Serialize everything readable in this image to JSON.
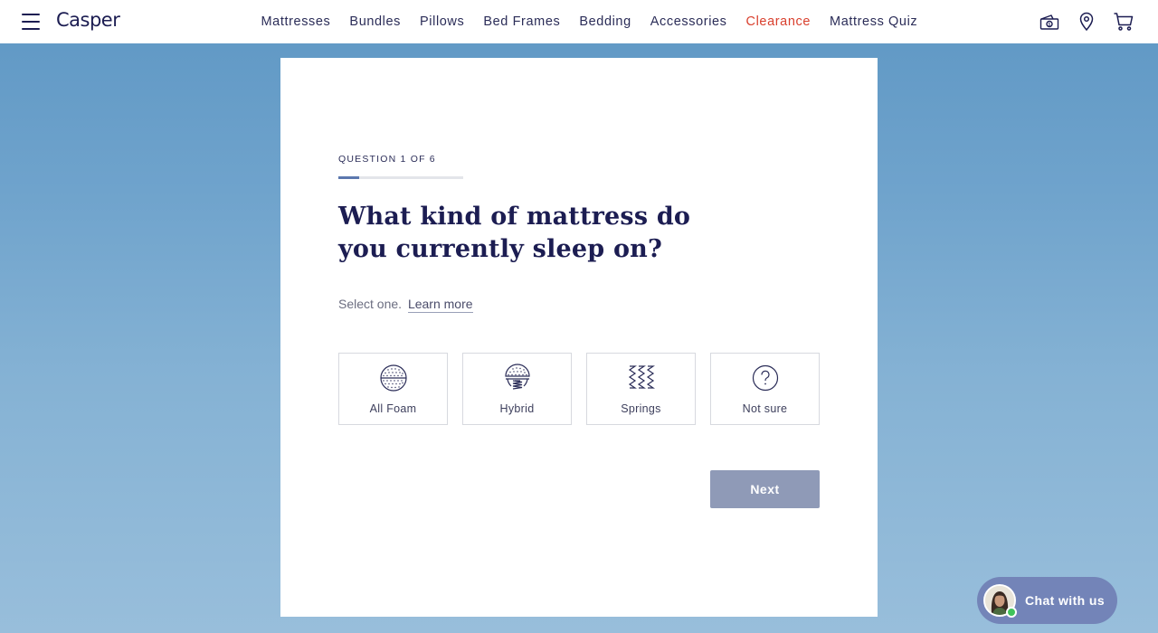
{
  "header": {
    "logo": "Casper",
    "nav": [
      "Mattresses",
      "Bundles",
      "Pillows",
      "Bed Frames",
      "Bedding",
      "Accessories",
      "Clearance",
      "Mattress Quiz"
    ],
    "icons": [
      "financing-icon",
      "location-pin-icon",
      "cart-icon"
    ]
  },
  "quiz": {
    "question_count": "QUESTION 1 OF 6",
    "progress": 0.1667,
    "title": "What kind of mattress do you currently sleep on?",
    "help_text": "Select one.",
    "learn_more": "Learn more",
    "options": [
      {
        "label": "All Foam",
        "icon": "foam-icon"
      },
      {
        "label": "Hybrid",
        "icon": "hybrid-icon"
      },
      {
        "label": "Springs",
        "icon": "springs-icon"
      },
      {
        "label": "Not sure",
        "icon": "question-icon"
      }
    ],
    "next_label": "Next"
  },
  "chat": {
    "label": "Chat with us",
    "status": "online"
  },
  "colors": {
    "brand_navy": "#1c1d52",
    "clearance_red": "#d9402e",
    "progress_fill": "#5c78ae",
    "next_button": "#8f9ab7",
    "chat_bubble": "#7384b8"
  }
}
